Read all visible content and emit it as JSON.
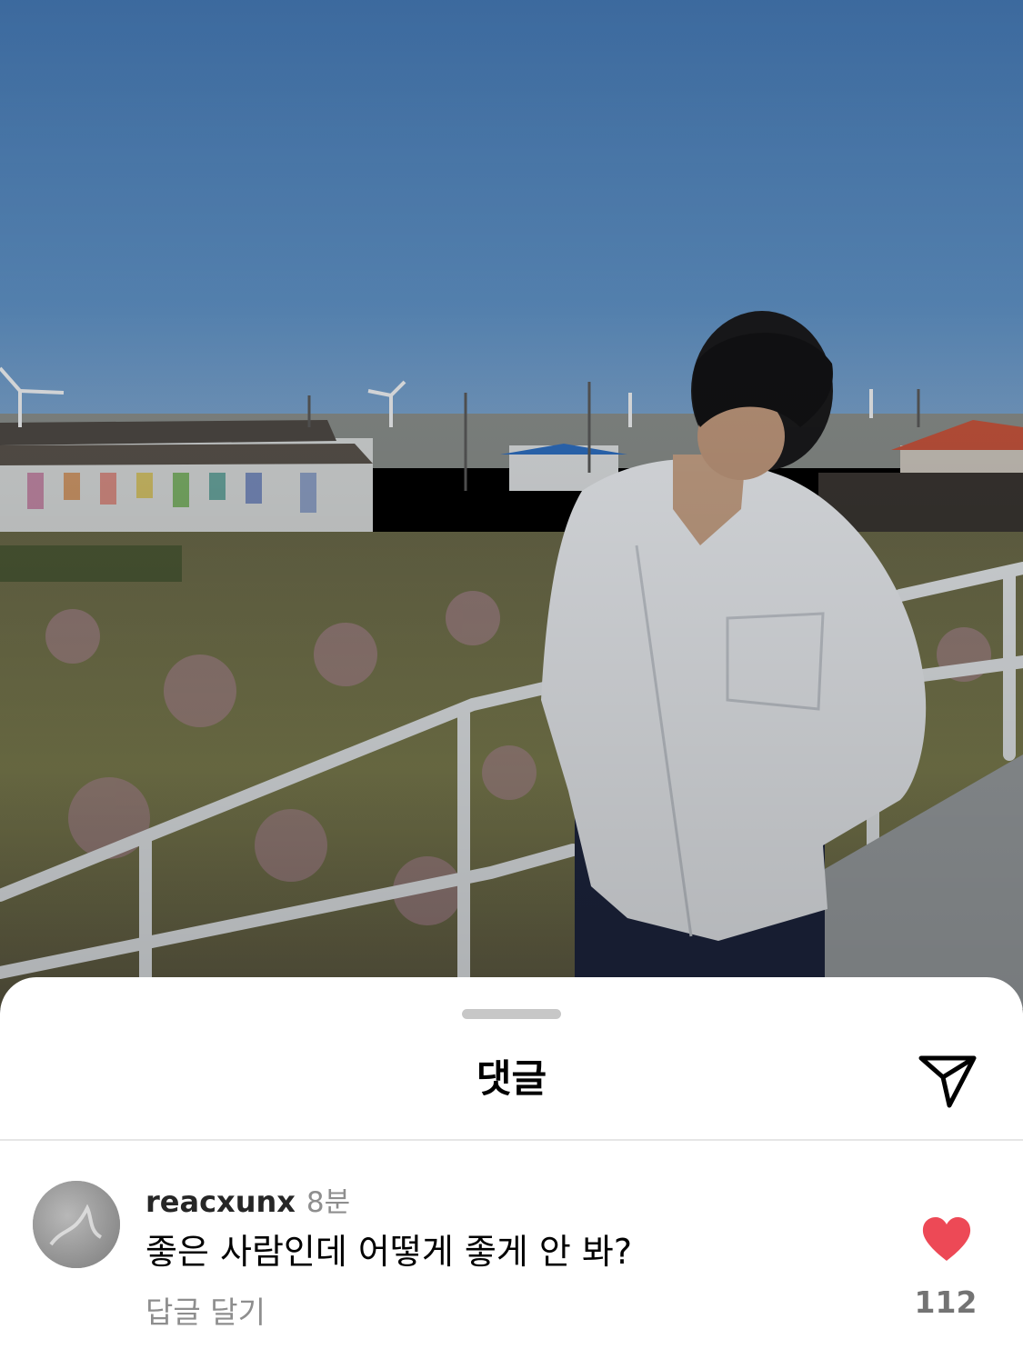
{
  "sheet": {
    "title": "댓글",
    "share_icon": "paper-plane-icon"
  },
  "comment": {
    "username": "reacxunx",
    "time": "8분",
    "text": "좋은 사람인데 어떻게 좋게 안 봐?",
    "reply_label": "답글 달기",
    "like_icon": "heart-icon",
    "like_color": "#ed4956",
    "like_count": "112"
  },
  "colors": {
    "sheet_background": "#ffffff",
    "muted_text": "#8e8e8e",
    "sky": "#4a7fb2"
  }
}
